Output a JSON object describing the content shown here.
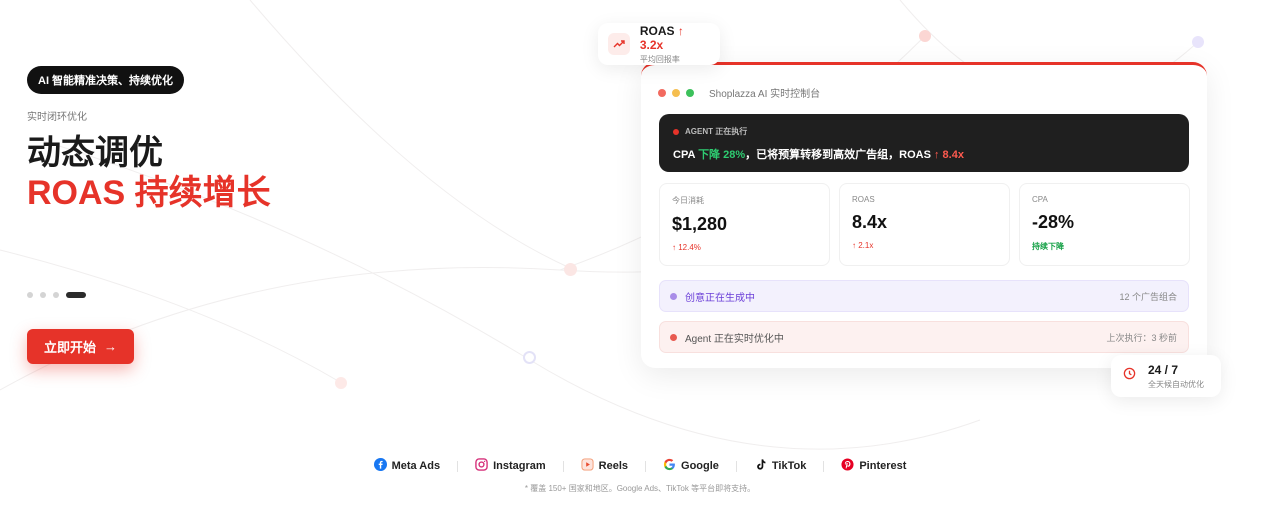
{
  "hero": {
    "pill": "AI 智能精准决策、持续优化",
    "eyebrow": "实时闭环优化",
    "title_line1": "动态调优",
    "title_line2": "ROAS 持续增长",
    "cta_label": "立即开始",
    "cta_arrow": "→",
    "carousel_active_index": 3,
    "carousel_count": 4
  },
  "roas_chip": {
    "label": "ROAS",
    "arrow": "↑",
    "value": "3.2x",
    "subtitle": "平均回报率",
    "icon": "trend-up-icon"
  },
  "dashboard": {
    "title": "Shoplazza AI 实时控制台",
    "agent": {
      "status": "AGENT 正在执行",
      "msg_prefix": "CPA",
      "msg_drop": "下降 28%",
      "msg_middle": "，已将预算转移到高效广告组，ROAS",
      "msg_roas": "↑ 8.4x"
    },
    "stats": [
      {
        "label": "今日消耗",
        "value": "$1,280",
        "delta": "↑ 12.4%"
      },
      {
        "label": "ROAS",
        "value": "8.4x",
        "delta": "↑ 2.1x"
      },
      {
        "label": "CPA",
        "value": "-28%",
        "delta": "持续下降"
      }
    ],
    "creative_bar": {
      "label": "创意正在生成中",
      "right": "12 个广告组合"
    },
    "agent_bar": {
      "label": "Agent 正在实时优化中",
      "right": "上次执行：3 秒前"
    }
  },
  "always_chip": {
    "title": "24 / 7",
    "subtitle": "全天候自动优化",
    "icon": "clock-icon"
  },
  "platforms": [
    {
      "name": "Meta Ads",
      "icon": "facebook-icon"
    },
    {
      "name": "Instagram",
      "icon": "instagram-icon"
    },
    {
      "name": "Reels",
      "icon": "reels-icon"
    },
    {
      "name": "Google",
      "icon": "google-icon"
    },
    {
      "name": "TikTok",
      "icon": "tiktok-icon"
    },
    {
      "name": "Pinterest",
      "icon": "pinterest-icon"
    }
  ],
  "footnote": "* 覆盖 150+ 国家和地区。Google Ads、TikTok 等平台即将支持。",
  "colors": {
    "accent": "#e63329",
    "dark": "#1f1f1f",
    "green": "#1aa34a",
    "purple": "#6b3fd8"
  }
}
